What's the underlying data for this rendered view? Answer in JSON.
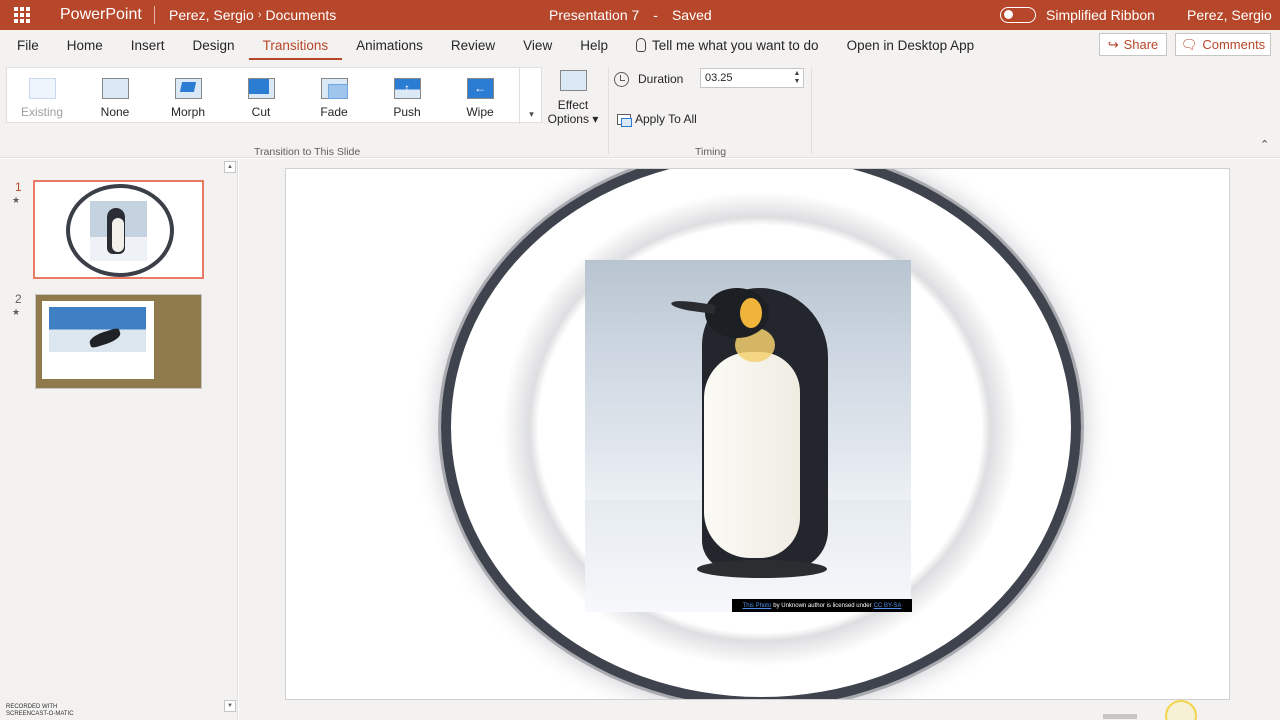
{
  "titlebar": {
    "app_name": "PowerPoint",
    "breadcrumb_owner": "Perez, Sergio",
    "breadcrumb_folder": "Documents",
    "doc_title": "Presentation 7",
    "doc_separator": "-",
    "save_status": "Saved",
    "simplified_ribbon_label": "Simplified Ribbon",
    "user_name": "Perez, Sergio"
  },
  "menu": {
    "items": [
      "File",
      "Home",
      "Insert",
      "Design",
      "Transitions",
      "Animations",
      "Review",
      "View",
      "Help"
    ],
    "active": "Transitions",
    "tell_me": "Tell me what you want to do",
    "open_desktop": "Open in Desktop App",
    "share": "Share",
    "comments": "Comments"
  },
  "ribbon": {
    "transitions": [
      "Existing",
      "None",
      "Morph",
      "Cut",
      "Fade",
      "Push",
      "Wipe"
    ],
    "effect_options_line1": "Effect",
    "effect_options_line2": "Options",
    "group_transition": "Transition to This Slide",
    "duration_label": "Duration",
    "duration_value": "03.25",
    "apply_all": "Apply To All",
    "group_timing": "Timing"
  },
  "slides": {
    "numbers": [
      "1",
      "2"
    ],
    "selected": "1"
  },
  "slide_content": {
    "caption_link": "This Photo",
    "caption_text": "by Unknown author is licensed under",
    "caption_license": "CC BY-SA"
  },
  "watermark": {
    "line1": "RECORDED WITH",
    "line2": "SCREENCAST-O-MATIC"
  },
  "colors": {
    "accent": "#b7472a",
    "selection": "#e97a63",
    "ribbon_bg": "#f3f2f1"
  }
}
